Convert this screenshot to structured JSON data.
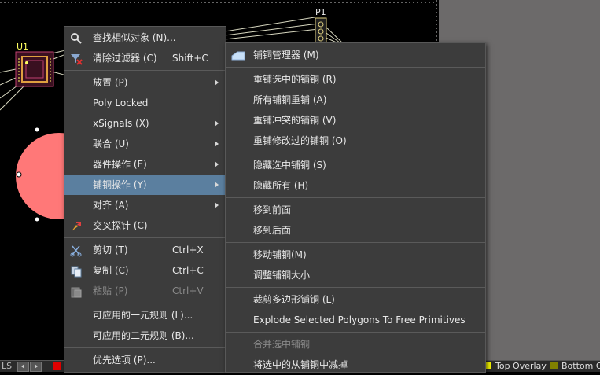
{
  "pcb": {
    "designator_u1": "U1",
    "designator_p1": "P1"
  },
  "main_menu": {
    "items": [
      {
        "label": "查找相似对象 (N)...",
        "shortcut": "",
        "icon": "binoculars-icon"
      },
      {
        "label": "清除过滤器 (C)",
        "shortcut": "Shift+C",
        "icon": "clear-filter-icon"
      },
      {
        "label": "放置 (P)",
        "shortcut": "",
        "submenu": true
      },
      {
        "label": "Poly Locked",
        "shortcut": ""
      },
      {
        "label": "xSignals (X)",
        "shortcut": "",
        "submenu": true
      },
      {
        "label": "联合 (U)",
        "shortcut": "",
        "submenu": true
      },
      {
        "label": "器件操作 (E)",
        "shortcut": "",
        "submenu": true
      },
      {
        "label": "铺铜操作 (Y)",
        "shortcut": "",
        "submenu": true,
        "highlighted": true
      },
      {
        "label": "对齐 (A)",
        "shortcut": "",
        "submenu": true
      },
      {
        "label": "交叉探针 (C)",
        "shortcut": "",
        "icon": "cross-probe-icon"
      },
      {
        "label": "剪切 (T)",
        "shortcut": "Ctrl+X",
        "icon": "scissors-icon"
      },
      {
        "label": "复制 (C)",
        "shortcut": "Ctrl+C",
        "icon": "copy-icon"
      },
      {
        "label": "粘贴 (P)",
        "shortcut": "Ctrl+V",
        "icon": "paste-icon",
        "disabled": true
      },
      {
        "label": "可应用的一元规则 (L)...",
        "shortcut": ""
      },
      {
        "label": "可应用的二元规则 (B)...",
        "shortcut": ""
      },
      {
        "label": "优先选项 (P)...",
        "shortcut": ""
      }
    ]
  },
  "sub_menu": {
    "items": [
      {
        "label": "铺铜管理器 (M)",
        "icon": "polygon-manager-icon"
      },
      {
        "label": "重铺选中的铺铜 (R)"
      },
      {
        "label": "所有铺铜重铺 (A)"
      },
      {
        "label": "重铺冲突的铺铜 (V)"
      },
      {
        "label": "重铺修改过的铺铜 (O)"
      },
      {
        "label": "隐藏选中铺铜 (S)"
      },
      {
        "label": "隐藏所有 (H)"
      },
      {
        "label": "移到前面"
      },
      {
        "label": "移到后面"
      },
      {
        "label": "移动铺铜(M)"
      },
      {
        "label": "调整铺铜大小"
      },
      {
        "label": "裁剪多边形铺铜 (L)"
      },
      {
        "label": "Explode Selected Polygons To Free Primitives"
      },
      {
        "label": "合并选中铺铜",
        "disabled": true
      },
      {
        "label": "将选中的从铺铜中减掉"
      }
    ]
  },
  "status_bar": {
    "left_tab": "LS",
    "layer_top_overlay": "Top Overlay",
    "layer_bottom": "Bottom O",
    "top_overlay_color": "#ffff00",
    "bottom_overlay_color": "#808000"
  },
  "colors": {
    "menu_bg": "#3c3c3c",
    "highlight": "#5b7f9f",
    "pad_pink": "#ff7878"
  }
}
